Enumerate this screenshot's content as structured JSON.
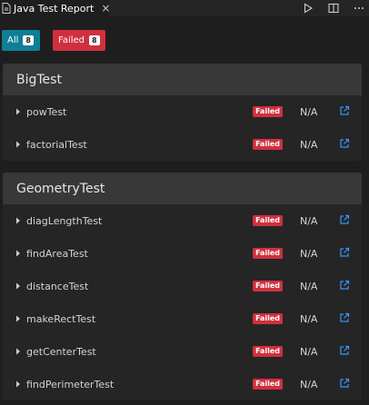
{
  "tab": {
    "title": "Java Test Report",
    "close_glyph": "×",
    "icons": [
      "document-icon",
      "run-icon",
      "split-editor-icon",
      "more-icon"
    ]
  },
  "filters": {
    "all": {
      "label": "All",
      "count": "8"
    },
    "failed": {
      "label": "Failed",
      "count": "8"
    }
  },
  "colors": {
    "all_button": "#0e7f97",
    "failed_button": "#d02f3e",
    "failed_badge": "#d02f3e",
    "link": "#3794ff"
  },
  "suites": [
    {
      "name": "BigTest",
      "tests": [
        {
          "name": "powTest",
          "status": "Failed",
          "duration": "N/A"
        },
        {
          "name": "factorialTest",
          "status": "Failed",
          "duration": "N/A"
        }
      ]
    },
    {
      "name": "GeometryTest",
      "tests": [
        {
          "name": "diagLengthTest",
          "status": "Failed",
          "duration": "N/A"
        },
        {
          "name": "findAreaTest",
          "status": "Failed",
          "duration": "N/A"
        },
        {
          "name": "distanceTest",
          "status": "Failed",
          "duration": "N/A"
        },
        {
          "name": "makeRectTest",
          "status": "Failed",
          "duration": "N/A"
        },
        {
          "name": "getCenterTest",
          "status": "Failed",
          "duration": "N/A"
        },
        {
          "name": "findPerimeterTest",
          "status": "Failed",
          "duration": "N/A"
        }
      ]
    }
  ]
}
